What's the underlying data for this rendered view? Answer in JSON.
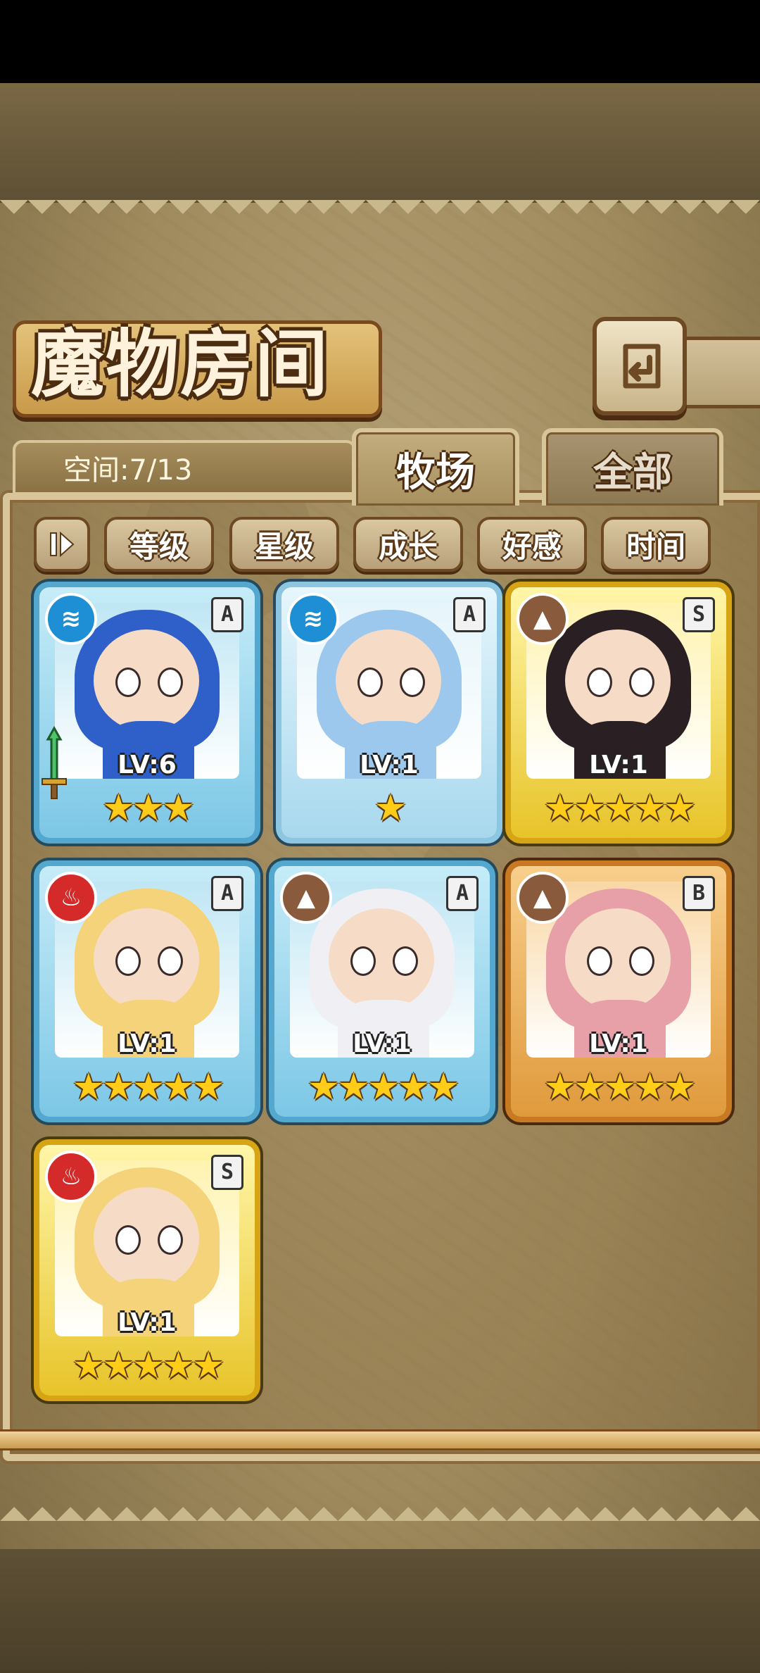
{
  "screen": {
    "title": "魔物房间",
    "space_label": "空间:7/13"
  },
  "tabs": {
    "pasture": "牧场",
    "all": "全部"
  },
  "sort_buttons": {
    "level": "等级",
    "star": "星级",
    "growth": "成长",
    "affection": "好感",
    "time": "时间"
  },
  "colors": {
    "water": "#1e8fd4",
    "earth": "#8a5a3c",
    "fire": "#d42a2a",
    "star": "#ffcc1a"
  },
  "cards": [
    {
      "element": "water",
      "element_icon": "water-icon",
      "rank": "A",
      "level": "LV:6",
      "stars": "★★★",
      "star_count": 3,
      "frame": "aqua",
      "hair": "#2f5fc8",
      "has_weapon": true
    },
    {
      "element": "water",
      "element_icon": "water-icon",
      "rank": "A",
      "level": "LV:1",
      "stars": "★",
      "star_count": 1,
      "frame": "pale",
      "hair": "#9cc8ee",
      "has_weapon": false
    },
    {
      "element": "earth",
      "element_icon": "earth-icon",
      "rank": "S",
      "level": "LV:1",
      "stars": "★★★★★",
      "star_count": 5,
      "frame": "gold",
      "hair": "#2a2024",
      "has_weapon": false
    },
    {
      "element": "fire",
      "element_icon": "fire-icon",
      "rank": "A",
      "level": "LV:1",
      "stars": "★★★★★",
      "star_count": 5,
      "frame": "aqua",
      "hair": "#f5d37a",
      "has_weapon": false
    },
    {
      "element": "earth",
      "element_icon": "earth-icon",
      "rank": "A",
      "level": "LV:1",
      "stars": "★★★★★",
      "star_count": 5,
      "frame": "aqua",
      "hair": "#f0f0f4",
      "has_weapon": false
    },
    {
      "element": "earth",
      "element_icon": "earth-icon",
      "rank": "B",
      "level": "LV:1",
      "stars": "★★★★★",
      "star_count": 5,
      "frame": "orange",
      "hair": "#e8a0a8",
      "has_weapon": false
    },
    {
      "element": "fire",
      "element_icon": "fire-icon",
      "rank": "S",
      "level": "LV:1",
      "stars": "★★★★★",
      "star_count": 5,
      "frame": "gold",
      "hair": "#f5d37a",
      "has_weapon": false
    }
  ]
}
